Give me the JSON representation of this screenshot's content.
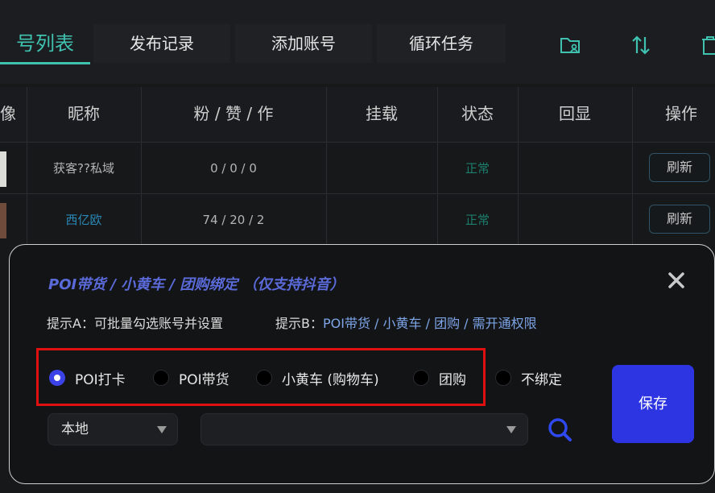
{
  "tabs": [
    {
      "label": "号列表",
      "active": true
    },
    {
      "label": "发布记录",
      "active": false
    },
    {
      "label": "添加账号",
      "active": false
    },
    {
      "label": "循环任务",
      "active": false
    }
  ],
  "toolbar_icons": [
    "folder-user-icon",
    "sort-icon",
    "trash-icon"
  ],
  "table": {
    "headers": [
      "昵称",
      "粉 / 赞 / 作",
      "挂载",
      "状态",
      "回显",
      "操作"
    ],
    "rows": [
      {
        "nickname": "获客??私域",
        "stats": "0 / 0 / 0",
        "mount": "",
        "status": "正常",
        "echo": "",
        "action": "刷新"
      },
      {
        "nickname": "西亿欧",
        "stats": "74 / 20 / 2",
        "mount": "",
        "status": "正常",
        "echo": "",
        "action": "刷新"
      }
    ]
  },
  "modal": {
    "title": "POI带货 / 小黄车 / 团购绑定  （仅支持抖音）",
    "hint_a": "提示A：可批量勾选账号并设置",
    "hint_b_label": "提示B：",
    "hint_b_value": "POI带货 / 小黄车 / 团购 / 需开通权限",
    "options": [
      {
        "label": "POI打卡",
        "checked": true
      },
      {
        "label": "POI带货",
        "checked": false
      },
      {
        "label": "小黄车 (购物车)",
        "checked": false
      },
      {
        "label": "团购",
        "checked": false
      },
      {
        "label": "不绑定",
        "checked": false
      }
    ],
    "save_label": "保存",
    "location_select": "本地",
    "poi_select": ""
  },
  "colors": {
    "accent": "#3fc3b0",
    "primary_button": "#2d35e3",
    "highlight_box": "#e01010",
    "title": "#5a6ad8",
    "link": "#2a89b8",
    "status_ok": "#1c7e6c"
  }
}
